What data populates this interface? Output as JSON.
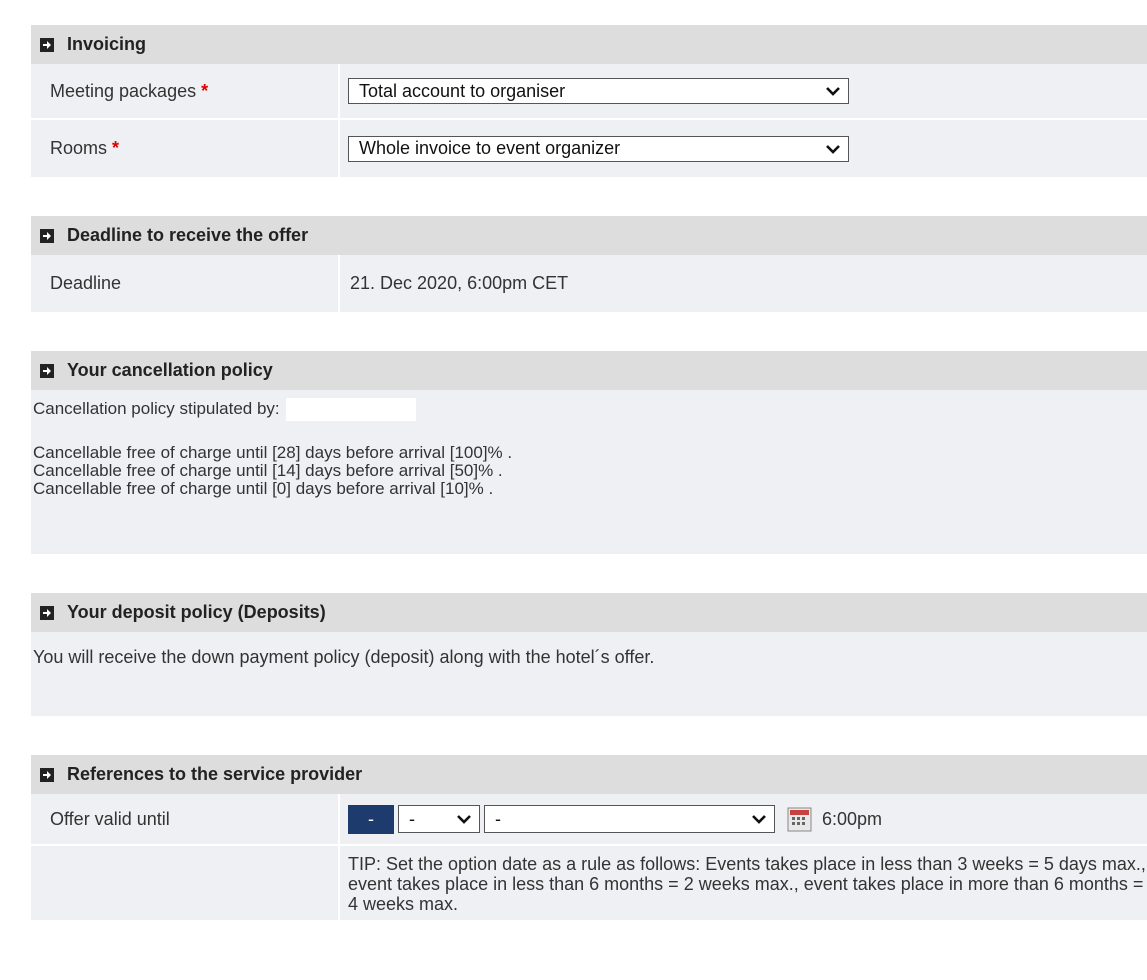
{
  "invoicing": {
    "title": "Invoicing",
    "meeting_packages_label": "Meeting packages",
    "meeting_packages_value": "Total account to organiser",
    "rooms_label": "Rooms",
    "rooms_value": "Whole invoice to event organizer",
    "required_mark": "*"
  },
  "deadline": {
    "title": "Deadline to receive the offer",
    "label": "Deadline",
    "value": "21. Dec 2020, 6:00pm CET"
  },
  "cancellation": {
    "title": "Your cancellation policy",
    "stipulated_label": "Cancellation policy stipulated by:",
    "lines": [
      "Cancellable free of charge until [28] days before arrival [100]% .",
      "Cancellable free of charge until [14] days before arrival [50]% .",
      "Cancellable free of charge until [0] days before arrival [10]% ."
    ]
  },
  "deposit": {
    "title": "Your deposit policy (Deposits)",
    "text": "You will receive the down payment policy (deposit) along with the hotel´s offer."
  },
  "references": {
    "title": "References to the service provider",
    "offer_valid_label": "Offer valid until",
    "day_button": "-",
    "month_value": "-",
    "year_value": "-",
    "time": "6:00pm",
    "tip": "TIP: Set the option date as a rule as follows: Events takes place in less than 3 weeks = 5 days max., event takes place in less than 6 months = 2 weeks max., event takes place in more than 6 months = 4 weeks max."
  },
  "icons": {
    "section": "section-arrow-icon",
    "dropdown": "chevron-down-icon",
    "calendar": "calendar-icon"
  },
  "colors": {
    "header_bg": "#dddddd",
    "body_bg": "#eef0f3",
    "required": "#dd0000",
    "date_button": "#1e3b6e"
  }
}
